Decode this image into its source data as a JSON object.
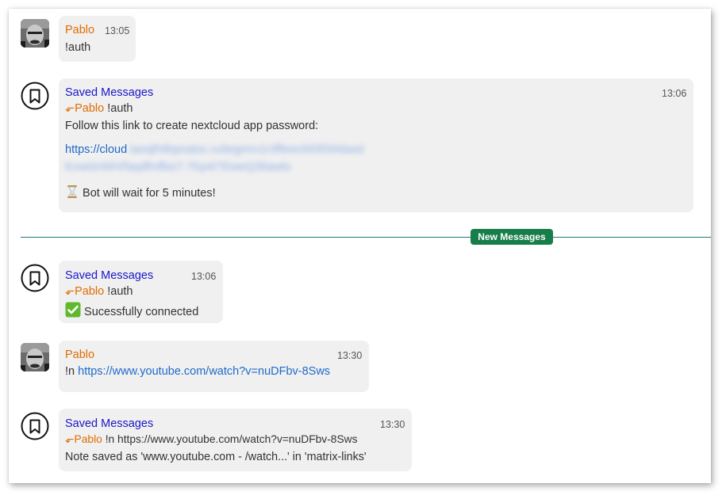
{
  "divider": {
    "label": "New Messages"
  },
  "messages": [
    {
      "sender": "Pablo",
      "time": "13:05",
      "body": "!auth"
    },
    {
      "sender": "Saved Messages",
      "time": "13:06",
      "reply_to": {
        "name": "Pablo",
        "text": "!auth"
      },
      "lines": [
        "Follow this link to create nextcloud app password:"
      ],
      "link_visible": "https://cloud",
      "link_blurred_1": ".laoqlh9bpnaloc.ru9egmrv1r3ffeeoW0l5Wdasd",
      "link_blurred_2": "fcow0nWH/faqdfmfbiz7.7Kp4/7EweQ36awlo",
      "wait_text": "Bot will wait for 5 minutes!"
    },
    {
      "sender": "Saved Messages",
      "time": "13:06",
      "reply_to": {
        "name": "Pablo",
        "text": "!auth"
      },
      "body": "Sucessfully connected"
    },
    {
      "sender": "Pablo",
      "time": "13:30",
      "prefix": "!n ",
      "link": "https://www.youtube.com/watch?v=nuDFbv-8Sws"
    },
    {
      "sender": "Saved Messages",
      "time": "13:30",
      "reply_to": {
        "name": "Pablo",
        "text": "!n https://www.youtube.com/watch?v=nuDFbv-8Sws"
      },
      "body": "Note saved as 'www.youtube.com - /watch...' in 'matrix-links'"
    }
  ],
  "icons": {
    "bot_avatar": "bookmark-icon",
    "reply": "reply-arrow-icon",
    "hourglass": "hourglass-icon",
    "check": "check-mark-icon"
  },
  "colors": {
    "pablo": "#e06c00",
    "saved": "#1a17c9",
    "link": "#1e6ac9",
    "badge": "#177d49",
    "divider": "#1d7a74"
  }
}
